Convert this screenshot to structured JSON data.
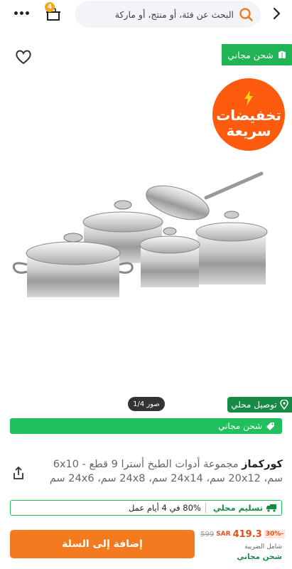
{
  "header": {
    "cart_count": "4",
    "search_placeholder": "البحث عن فئة، أو منتج، أو ماركة"
  },
  "product_gallery": {
    "free_shipping_badge": "شحن مجاني",
    "flash_sale_line1": "تخفيضات",
    "flash_sale_line2": "سريعة",
    "photos_counter": "صور 1/4",
    "local_delivery_badge": "توصيل محلي",
    "free_shipping_bar": "شحن مجاني"
  },
  "product": {
    "brand": "كوركماز",
    "title": " مجموعة أدوات الطبخ أسترا 9 قطع - 6x10 سم، 20x12 سم، 24x14 سم، 24x8 سم، 24x6 سم"
  },
  "delivery": {
    "label": "تسليم محلي",
    "detail": "80% في 4 أيام عمل"
  },
  "pricing": {
    "discount": "30%-",
    "price": "419.3",
    "currency": "SAR",
    "old_price": "599",
    "tax_note": "شامل الضريبة",
    "shipping": "شحن مجاني"
  },
  "actions": {
    "add_to_cart": "إضافة إلى السلة"
  },
  "colors": {
    "green": "#20c05c",
    "orange": "#f47a1f",
    "flash": "#ff5b0f"
  }
}
